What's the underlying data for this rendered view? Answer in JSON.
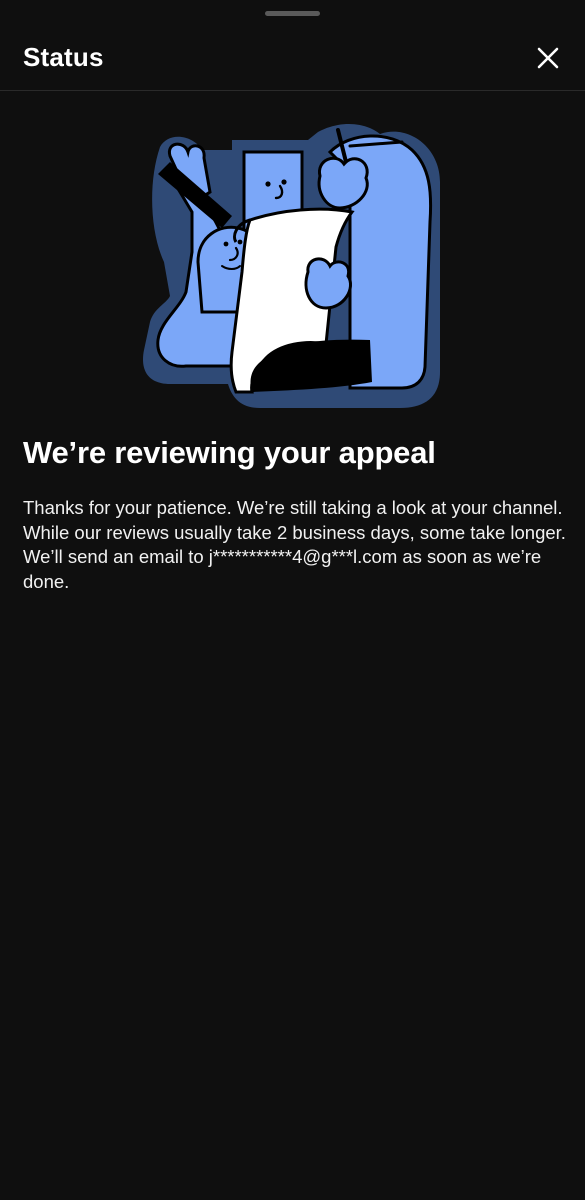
{
  "header": {
    "title": "Status"
  },
  "icons": {
    "close": "close-icon",
    "illustration": "appeal-review-illustration"
  },
  "colors": {
    "background": "#0f0f0f",
    "illustration_blue": "#7ba7f8",
    "illustration_outline": "#2f4a76"
  },
  "content": {
    "heading": "We’re reviewing your appeal",
    "body": "Thanks for your patience. We’re still taking a look at your channel. While our reviews usually take 2 business days, some take longer. We’ll send an email to j***********4@g***l.com as soon as we’re done."
  }
}
